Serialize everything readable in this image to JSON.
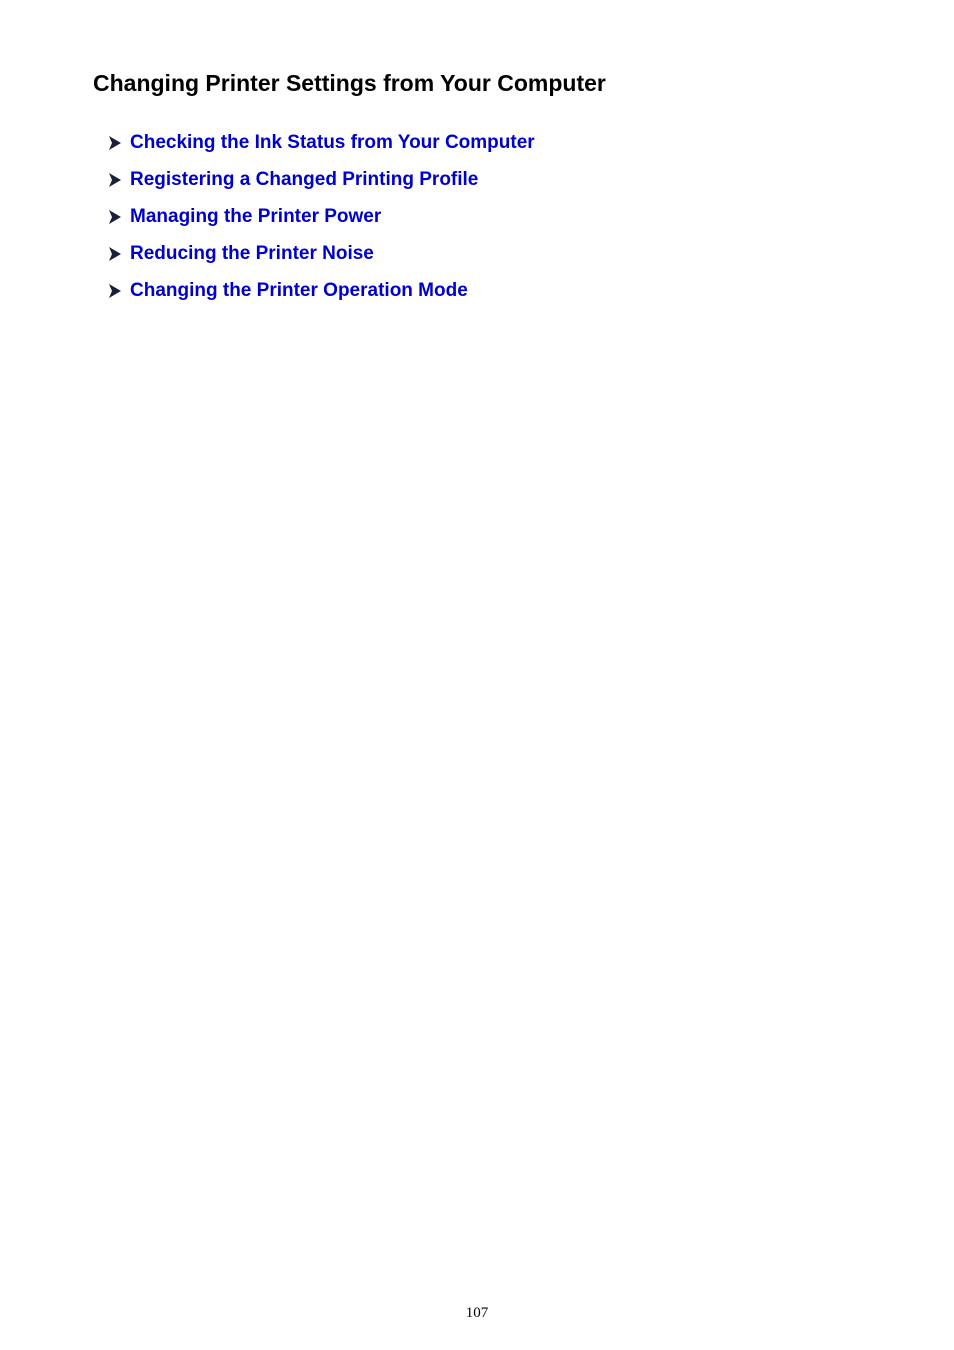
{
  "page": {
    "title": "Changing Printer Settings from Your Computer",
    "links": [
      {
        "label": "Checking the Ink Status from Your Computer",
        "icon": "arrow-right-icon"
      },
      {
        "label": "Registering a Changed Printing Profile",
        "icon": "arrow-right-icon"
      },
      {
        "label": "Managing the Printer Power",
        "icon": "arrow-right-icon"
      },
      {
        "label": "Reducing the Printer Noise",
        "icon": "arrow-right-icon"
      },
      {
        "label": "Changing the Printer Operation Mode",
        "icon": "arrow-right-icon"
      }
    ],
    "page_number": "107"
  },
  "colors": {
    "link": "#0000cc",
    "title": "#000000",
    "arrow": "#1a1f3a"
  }
}
